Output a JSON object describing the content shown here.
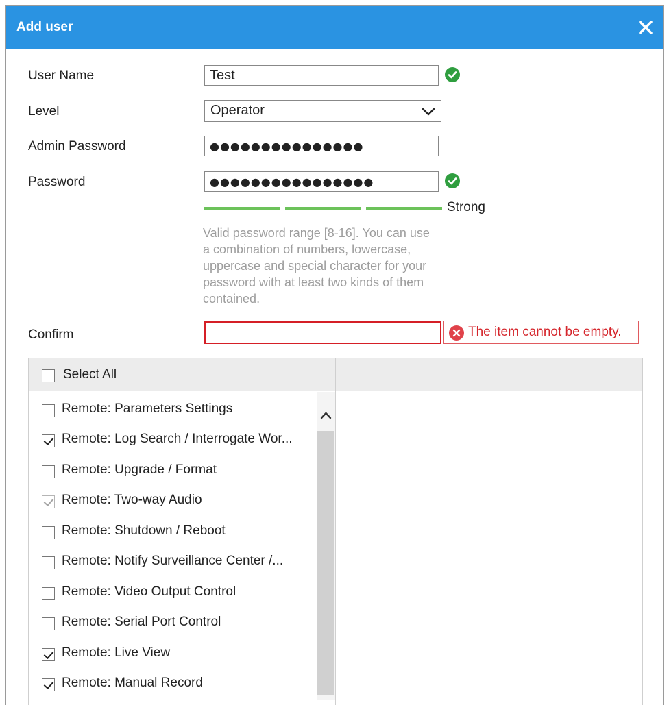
{
  "dialog": {
    "title": "Add user",
    "close_icon": "close-icon"
  },
  "form": {
    "username": {
      "label": "User Name",
      "value": "Test",
      "valid": true
    },
    "level": {
      "label": "Level",
      "value": "Operator"
    },
    "admin_password": {
      "label": "Admin Password",
      "masked": "●●●●●●●●●●●●●●●"
    },
    "password": {
      "label": "Password",
      "masked": "●●●●●●●●●●●●●●●●",
      "valid": true,
      "strength_label": "Strong",
      "strength_segments_filled": 3,
      "strength_segments_total": 3,
      "hint": "Valid password range [8-16]. You can use a combination of numbers, lowercase, uppercase and special character for your password with at least two kinds of them contained."
    },
    "confirm": {
      "label": "Confirm",
      "value": "",
      "error": "The item cannot be empty."
    }
  },
  "permissions": {
    "select_all_label": "Select All",
    "items": [
      {
        "label": "Remote: Parameters Settings",
        "checked": false,
        "disabled": false
      },
      {
        "label": "Remote: Log Search / Interrogate Wor...",
        "checked": true,
        "disabled": false
      },
      {
        "label": "Remote: Upgrade / Format",
        "checked": false,
        "disabled": false
      },
      {
        "label": "Remote: Two-way Audio",
        "checked": true,
        "disabled": true
      },
      {
        "label": "Remote: Shutdown / Reboot",
        "checked": false,
        "disabled": false
      },
      {
        "label": "Remote: Notify Surveillance Center /...",
        "checked": false,
        "disabled": false
      },
      {
        "label": "Remote: Video Output Control",
        "checked": false,
        "disabled": false
      },
      {
        "label": "Remote: Serial Port Control",
        "checked": false,
        "disabled": false
      },
      {
        "label": "Remote: Live View",
        "checked": true,
        "disabled": false
      },
      {
        "label": "Remote: Manual Record",
        "checked": true,
        "disabled": false
      }
    ]
  },
  "colors": {
    "titlebar": "#2a93e2",
    "valid_green": "#2f9e3f",
    "strength_green": "#6cc25a",
    "error_red": "#d51f26"
  }
}
